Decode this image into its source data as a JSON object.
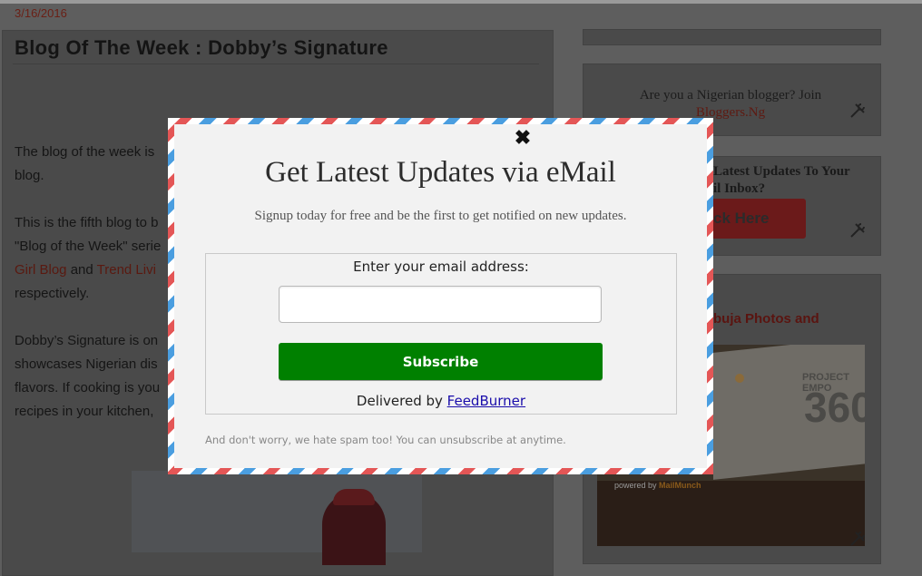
{
  "post": {
    "date": "3/16/2016",
    "title": "Blog Of The Week : Dobby’s Signature",
    "p1_a": "The blog of the week is",
    "p1_b": "blog.",
    "p2_a": "This is the fifth blog to b",
    "p2_b": "\"Blog of the Week\" serie",
    "p2_link1": "Girl Blog",
    "p2_and": " and ",
    "p2_link2": "Trend Livi",
    "p2_c": "respectively.",
    "p3_a": "Dobby’s Signature is on",
    "p3_b": "showcases Nigerian dis",
    "p3_c": "flavors. If cooking is you",
    "p3_d": "recipes in your kitchen,"
  },
  "sidebar": {
    "join_text": "Are you a Nigerian blogger? Join",
    "join_link": "Bloggers.Ng",
    "updates_line1": "Latest Updates To Your",
    "updates_line2": "il Inbox?",
    "click_button": "ck Here",
    "abuja_title": "buja Photos and",
    "photo_number": "360",
    "photo_text": "PROJECT EMPO",
    "powered_by": "powered by ",
    "powered_brand": "MailMunch"
  },
  "modal": {
    "close_glyph": "✖",
    "title": "Get Latest Updates via eMail",
    "subtitle": "Signup today for free and be the first to get notified on new updates.",
    "email_label": "Enter your email address:",
    "email_value": "",
    "subscribe_label": "Subscribe",
    "delivered_prefix": "Delivered by ",
    "delivered_link": "FeedBurner",
    "spam_note": "And don't worry, we hate spam too! You can unsubscribe at anytime."
  },
  "icons": {
    "close": "close-icon",
    "tools": "wrench-screwdriver-icon"
  },
  "colors": {
    "overlay": "#5e5e5e",
    "subscribe_green": "#008000",
    "airmail_red": "#e45656",
    "airmail_blue": "#4a9ee0",
    "link_red": "#5e1a12"
  }
}
